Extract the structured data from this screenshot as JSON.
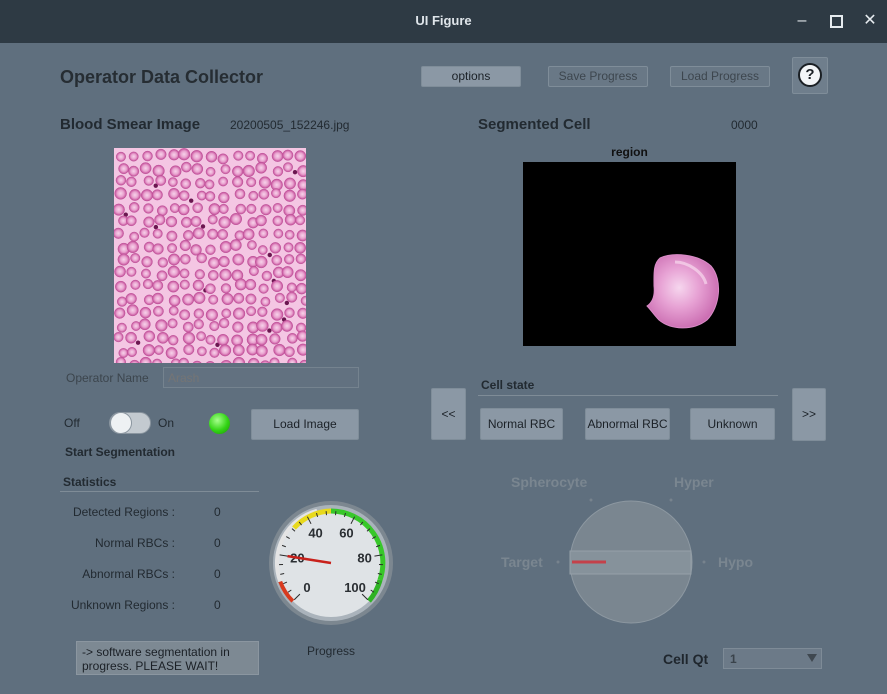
{
  "window": {
    "title": "UI Figure",
    "minimize": "–",
    "maximize": "☐",
    "close": "✕"
  },
  "header": {
    "title": "Operator Data Collector",
    "options_label": "options",
    "save_label": "Save Progress",
    "load_label": "Load Progress",
    "help_icon": "question-circle-icon",
    "help_glyph": "?"
  },
  "left": {
    "section_title": "Blood Smear Image",
    "filename": "20200505_152246.jpg",
    "operator_label": "Operator Name",
    "operator_placeholder": "Arash",
    "switch_off": "Off",
    "switch_on": "On",
    "switch_state": "off",
    "lamp_color": "#32d414",
    "load_image_label": "Load Image",
    "start_segmentation": "Start Segmentation",
    "stats_title": "Statistics",
    "stats": [
      {
        "label": "Detected Regions :",
        "value": "0"
      },
      {
        "label": "Normal RBCs :",
        "value": "0"
      },
      {
        "label": "Abnormal RBCs :",
        "value": "0"
      },
      {
        "label": "Unknown Regions :",
        "value": "0"
      }
    ],
    "message": "-> software segmentation in progress. PLEASE WAIT!",
    "gauge": {
      "ticks": [
        "0",
        "20",
        "40",
        "60",
        "80",
        "100"
      ],
      "value": 20,
      "label": "Progress"
    }
  },
  "right": {
    "section_title": "Segmented Cell",
    "cell_id": "0000",
    "plot_title": "region",
    "cell_state_title": "Cell state",
    "prev_label": "<<",
    "next_label": ">>",
    "normal_label": "Normal RBC",
    "abnormal_label": "Abnormal RBC",
    "unknown_label": "Unknown",
    "knob": {
      "positions": [
        "Target",
        "Spherocyte",
        "Hyper",
        "Hypo"
      ],
      "selected": "Target"
    },
    "cell_qt_label": "Cell Qt",
    "cell_qt_value": "1"
  },
  "colors": {
    "background": "#5f6f7e",
    "titlebar": "#2e3a44",
    "accent_red": "#d0302a",
    "lamp": "#32d414"
  }
}
